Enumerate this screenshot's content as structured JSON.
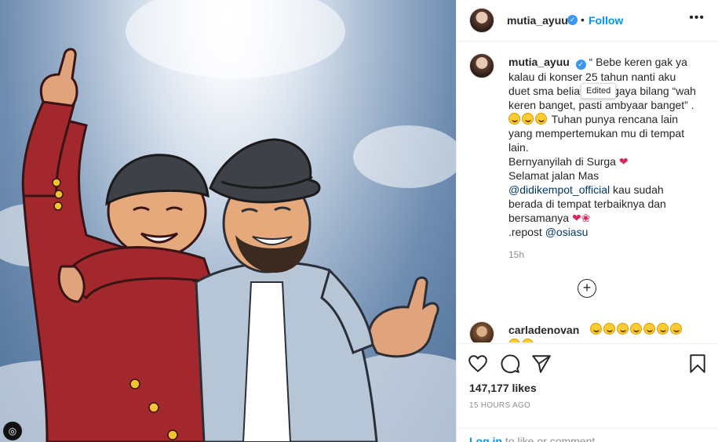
{
  "post": {
    "username": "mutia_ayuu",
    "follow_label": "Follow",
    "separator": "•",
    "more_label": "•••"
  },
  "caption": {
    "username": "mutia_ayuu",
    "lines": [
      "“ Bebe keren gak ya",
      "kalau di konser 25 tahun nanti aku",
      "duet sma beliau, aku gaya bilang “wah",
      "keren banget, pasti ambyaar banget” ."
    ],
    "line5": "Tuhan punya rencana lain",
    "line6": "yang mempertemukan mu di tempat",
    "line7": "lain.",
    "line8": "Bernyanyilah di Surga",
    "line9": "Selamat jalan Mas",
    "mention1": "@didikempot_official",
    "line10": " kau sudah",
    "line11": "berada di tempat terbaiknya dan",
    "line12": "bersamanya",
    "repost_label": ".repost ",
    "mention2": "@osiasu",
    "time_ago": "15h"
  },
  "tooltip": "Edited",
  "load_more_symbol": "+",
  "comment": {
    "username": "carladenovan"
  },
  "actions": {
    "likes": "147,177 likes",
    "posted": "15 HOURS AGO"
  },
  "login": {
    "login_label": "Log in",
    "rest": " to like or comment."
  },
  "colors": {
    "accent": "#0095f6",
    "verified": "#3897f0",
    "jacket_red": "#a3282e",
    "jacket_grey": "#b7c6d6",
    "hat": "#3f4148"
  }
}
